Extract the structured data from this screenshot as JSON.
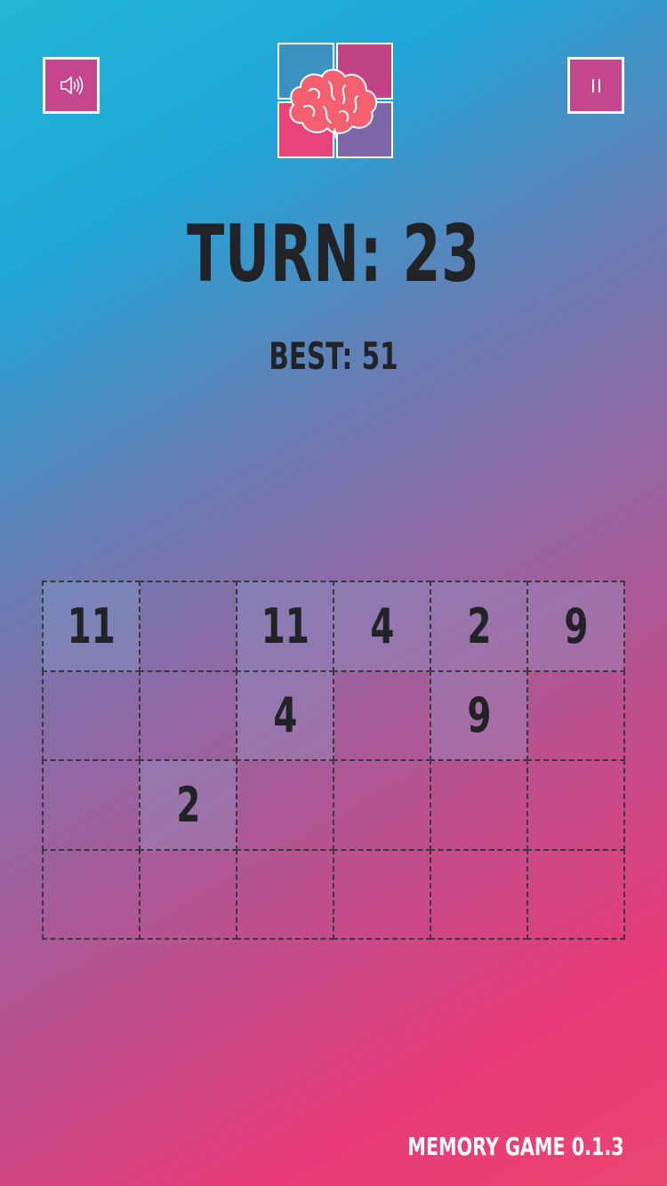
{
  "header": {
    "sound_icon": "speaker-volume-icon",
    "pause_icon": "pause-icon",
    "logo_icon": "brain-icon"
  },
  "status": {
    "turn_label": "TURN: 23",
    "best_label": "BEST: 51"
  },
  "board": {
    "rows": 4,
    "cols": 6,
    "cells": [
      [
        "11",
        "",
        "11",
        "4",
        "2",
        "9"
      ],
      [
        "",
        "",
        "4",
        "",
        "9",
        ""
      ],
      [
        "",
        "2",
        "",
        "",
        "",
        ""
      ],
      [
        "",
        "",
        "",
        "",
        "",
        ""
      ]
    ]
  },
  "footer": {
    "version": "MEMORY GAME 0.1.3"
  },
  "colors": {
    "button_bg": "#c4468d",
    "text_dark": "#222327",
    "gradient_start": "#22b6d4",
    "gradient_end": "#ea4670"
  }
}
